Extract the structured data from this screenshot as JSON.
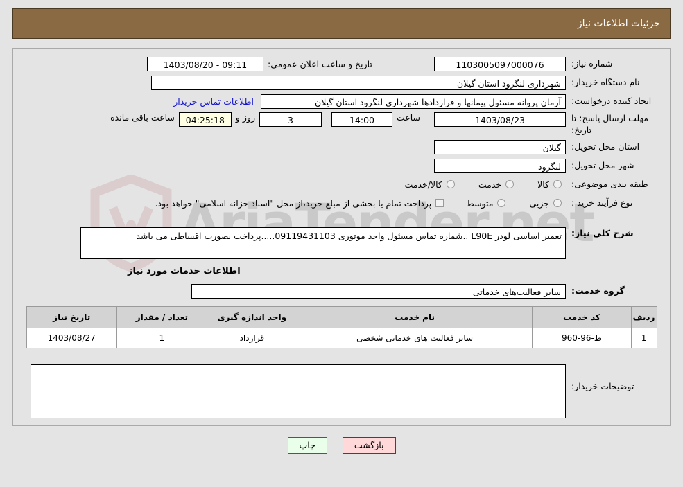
{
  "header": {
    "title": "جزئیات اطلاعات نیاز",
    "bg_color": "#8a6a42",
    "text_color": "#ffffff"
  },
  "watermark": {
    "text": "AriaTender.net",
    "logo": "shield-logo",
    "logo_color": "#c8a0a4"
  },
  "form": {
    "need_number_label": "شماره نیاز:",
    "need_number_value": "1103005097000076",
    "announce_datetime_label": "تاریخ و ساعت اعلان عمومی:",
    "announce_datetime_value": "09:11 - 1403/08/20",
    "buyer_org_label": "نام دستگاه خریدار:",
    "buyer_org_value": "شهرداری لنگرود استان گیلان",
    "requester_label": "ایجاد کننده درخواست:",
    "requester_value": "آرمان پروانه مسئول پیمانها و قراردادها شهرداری لنگرود استان گیلان",
    "contact_link": "اطلاعات تماس خریدار",
    "deadline_label": "مهلت ارسال پاسخ: تا تاریخ:",
    "deadline_date": "1403/08/23",
    "hour_label": "ساعت",
    "deadline_time": "14:00",
    "days_remaining": "3",
    "days_label": "روز و",
    "time_remaining": "04:25:18",
    "time_remaining_label": "ساعت باقی مانده",
    "province_label": "استان محل تحویل:",
    "province_value": "گیلان",
    "city_label": "شهر محل تحویل:",
    "city_value": "لنگرود",
    "category_label": "طبقه بندی موضوعی:",
    "category_options": [
      {
        "label": "کالا",
        "selected": false
      },
      {
        "label": "خدمت",
        "selected": false
      },
      {
        "label": "کالا/خدمت",
        "selected": false
      }
    ],
    "purchase_type_label": "نوع فرآیند خرید :",
    "purchase_type_options": [
      {
        "label": "جزیی",
        "selected": false
      },
      {
        "label": "متوسط",
        "selected": false
      }
    ],
    "treasury_checkbox_label": "پرداخت تمام یا بخشی از مبلغ خرید،از محل \"اسناد خزانه اسلامی\" خواهد بود.",
    "treasury_checked": false
  },
  "description": {
    "label": "شرح کلی نیاز:",
    "value": "تعمیر اساسی لودر L90E ..شماره تماس مسئول واحد موتوری 09119431103.....پرداخت بصورت اقساطی می باشد"
  },
  "services": {
    "section_title": "اطلاعات خدمات مورد نیاز",
    "group_label": "گروه خدمت:",
    "group_value": "سایر فعالیت‌های خدماتی",
    "table": {
      "headers": [
        "ردیف",
        "کد خدمت",
        "نام خدمت",
        "واحد اندازه گیری",
        "تعداد / مقدار",
        "تاریخ نیاز"
      ],
      "rows": [
        {
          "row": "1",
          "code": "ط-96-960",
          "name": "سایر فعالیت های خدماتی شخصی",
          "unit": "قرارداد",
          "quantity": "1",
          "need_date": "1403/08/27"
        }
      ]
    }
  },
  "buyer_notes": {
    "label": "توضیحات خریدار:",
    "value": ""
  },
  "buttons": {
    "back": "بازگشت",
    "print": "چاپ"
  }
}
